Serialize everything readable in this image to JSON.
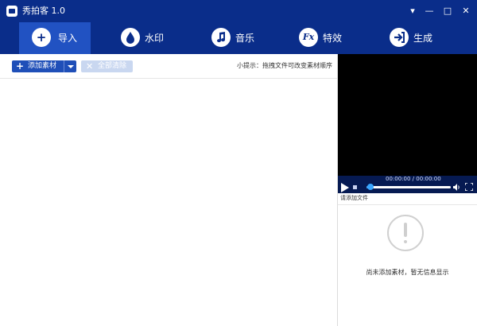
{
  "window": {
    "title": "秀拍客 1.0",
    "controls": {
      "menu": "▾",
      "minimize": "—",
      "maximize": "□",
      "close": "✕"
    }
  },
  "toolbar": {
    "tabs": [
      {
        "label": "导入",
        "icon": "plus-icon",
        "active": true
      },
      {
        "label": "水印",
        "icon": "droplet-icon",
        "active": false
      },
      {
        "label": "音乐",
        "icon": "music-note-icon",
        "active": false
      },
      {
        "label": "特效",
        "icon": "fx-icon",
        "active": false
      },
      {
        "label": "生成",
        "icon": "export-icon",
        "active": false
      }
    ]
  },
  "left": {
    "add_label": "添加素材",
    "clear_label": "全部清除",
    "hint_label": "小提示：",
    "hint_text": "拖拽文件可改变素材顺序"
  },
  "player": {
    "time": "00:00:00 / 00:00:00",
    "progress": 0.05,
    "status": "请添加文件"
  },
  "info": {
    "empty_text": "尚未添加素材，暂无信息显示"
  },
  "colors": {
    "titlebar": "#0a2d8a",
    "active_tab": "#2152c2",
    "button": "#1f4fb8",
    "progress": "#39a6ff"
  }
}
